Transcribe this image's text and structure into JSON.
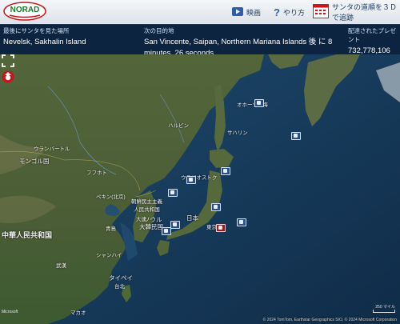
{
  "header": {
    "logo_text": "NORAD",
    "video_label": "映画",
    "help_label": "やり方",
    "track3d_label": "サンタの道順を３Ｄで追跡"
  },
  "info": {
    "last_seen_label": "最後にサンタを見た場所",
    "last_seen_value": "Nevelsk, Sakhalin Island",
    "next_stop_label": "次の目的地",
    "next_stop_value": "San Vincente, Saipan, Northern Mariana Islands 後 に 8 minutes, 26 seconds",
    "gifts_label": "配達されたプレゼント",
    "gifts_value": "732,778,106"
  },
  "map": {
    "labels": {
      "china": "中華人民共和国",
      "mongolia": "モンゴル国",
      "ulaanbaatar": "ウランバートル",
      "nk": "朝鮮民主主義\n人民共和国",
      "seoul": "ソウル",
      "korea": "大韓民国",
      "japan": "日本",
      "tokyo": "東京",
      "beijing": "ペキン(北京)",
      "taipei": "台北",
      "taiwan": "タイペイ",
      "okhotsk": "オホーツク海",
      "harbin": "ハルビン",
      "shanghai": "シャンハイ",
      "hohhot": "フフホト",
      "dalian": "大連",
      "qingdao": "青島",
      "vladivostok": "ウラジオストク",
      "wuhan": "武漢",
      "macau": "マカオ",
      "sakhalin": "サハリン"
    },
    "scale": "250 マイル",
    "attribution": "© 2024 TomTom, Earthstar Geographics SIO, © 2024 Microsoft Corporation",
    "brand": "Microsoft"
  }
}
